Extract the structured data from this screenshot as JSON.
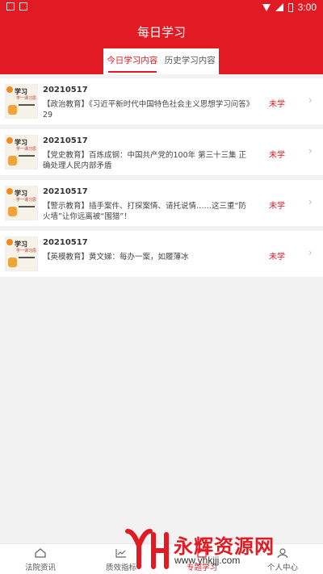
{
  "status_bar": {
    "time": "3:00"
  },
  "header": {
    "title": "每日学习",
    "tabs": [
      {
        "label": "今日学习内容",
        "active": true
      },
      {
        "label": "历史学习内容",
        "active": false
      }
    ]
  },
  "items": [
    {
      "date": "20210517",
      "title": "【政治教育】《习近平新时代中国特色社会主义思想学习问答》29",
      "status": "未学",
      "thumb_title": "学习",
      "thumb_sub": "学一课习思"
    },
    {
      "date": "20210517",
      "title": "【党史教育】百炼成钢：中国共产党的100年 第三十三集 正确处理人民内部矛盾",
      "status": "未学",
      "thumb_title": "学习",
      "thumb_sub": "学一课习思"
    },
    {
      "date": "20210517",
      "title": "【警示教育】插手案件、打探案情、请托说情……这三重“防火墙”让你远离被“围猎”！",
      "status": "未学",
      "thumb_title": "学习",
      "thumb_sub": "学一课习思"
    },
    {
      "date": "20210517",
      "title": "【英模教育】黄文娣：每办一案，如履薄冰",
      "status": "未学",
      "thumb_title": "学习",
      "thumb_sub": "学一课习思"
    }
  ],
  "bottom_nav": [
    {
      "label": "法院资讯",
      "icon": "home-icon"
    },
    {
      "label": "质效指标",
      "icon": "chart-icon"
    },
    {
      "label": "专题学习",
      "icon": "book-icon",
      "active": true
    },
    {
      "label": "个人中心",
      "icon": "user-icon"
    }
  ],
  "watermark": {
    "brand": "永辉资源网",
    "url": "www.yhkjjj.com"
  },
  "colors": {
    "accent": "#e21a23",
    "background": "#f2f2f2"
  }
}
